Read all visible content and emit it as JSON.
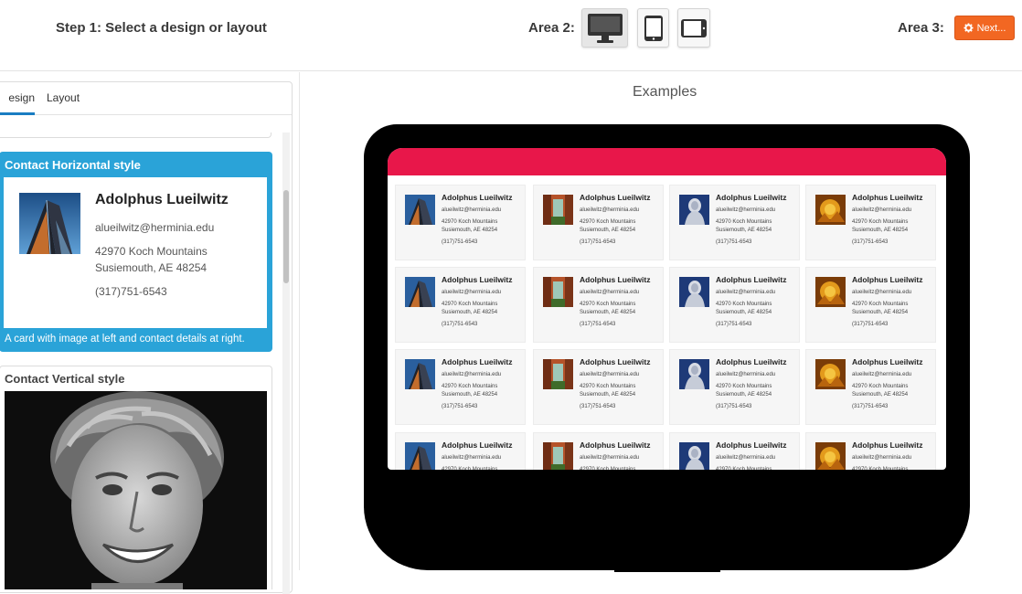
{
  "header": {
    "step1_label": "Step 1: Select a design or layout",
    "area2_label": "Area 2:",
    "area3_label": "Area 3:",
    "next_label": "Next...",
    "devices": [
      "desktop-icon",
      "tablet-portrait-icon",
      "tablet-landscape-icon"
    ],
    "active_device": "desktop"
  },
  "left_panel": {
    "tabs": {
      "design": "esign",
      "layout": "Layout"
    },
    "active_tab": "design",
    "cards": [
      {
        "title": "Contact Horizontal style",
        "name": "Adolphus Lueilwitz",
        "email": "alueilwitz@herminia.edu",
        "address_line1": "42970 Koch Mountains",
        "address_line2": "Susiemouth, AE  48254",
        "phone": "(317)751-6543",
        "description": "A card with image at left and contact details at right.",
        "selected": true
      },
      {
        "title": "Contact Vertical style"
      }
    ]
  },
  "preview": {
    "title": "Examples",
    "contact": {
      "name": "Adolphus Lueilwitz",
      "email": "alueilwitz@herminia.edu",
      "address_line1": "42970 Koch Mountains",
      "address_line2": "Susiemouth, AE  48254",
      "phone": "(317)751-6543"
    },
    "image_themes": [
      "building",
      "canyon",
      "statue",
      "golden"
    ]
  },
  "colors": {
    "accent_blue": "#2aa3d8",
    "next_orange": "#f26722",
    "banner_red": "#e8174a"
  }
}
